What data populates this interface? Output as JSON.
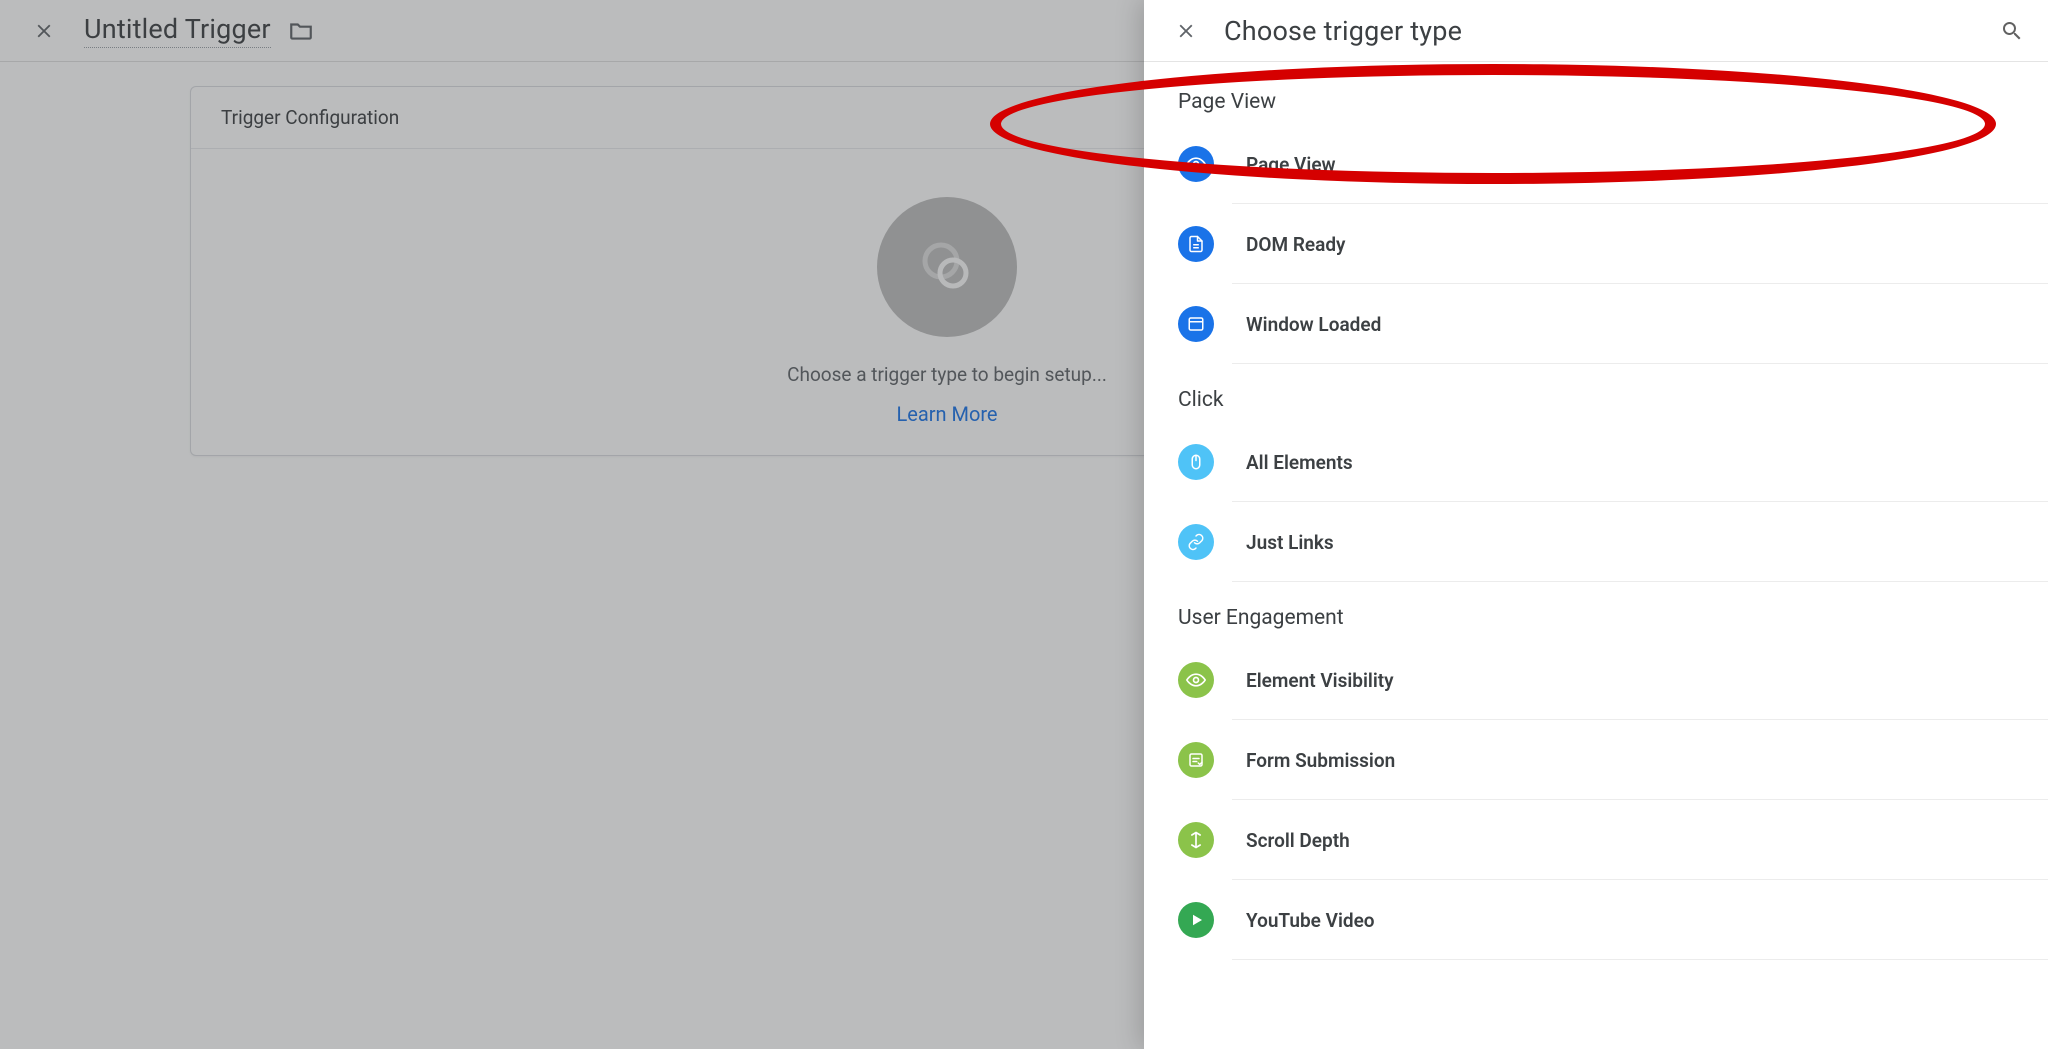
{
  "back": {
    "title": "Untitled Trigger",
    "card_title": "Trigger Configuration",
    "prompt": "Choose a trigger type to begin setup...",
    "learn_more": "Learn More"
  },
  "drawer": {
    "title": "Choose trigger type",
    "groups": [
      {
        "title": "Page View",
        "items": [
          {
            "name": "pageview",
            "label": "Page View",
            "icon": "eye-icon",
            "color": "ic-blue"
          },
          {
            "name": "dom-ready",
            "label": "DOM Ready",
            "icon": "doc-icon",
            "color": "ic-blue"
          },
          {
            "name": "window-loaded",
            "label": "Window Loaded",
            "icon": "window-icon",
            "color": "ic-blue"
          }
        ]
      },
      {
        "title": "Click",
        "items": [
          {
            "name": "all-elements",
            "label": "All Elements",
            "icon": "mouse-icon",
            "color": "ic-lblue"
          },
          {
            "name": "just-links",
            "label": "Just Links",
            "icon": "link-icon",
            "color": "ic-lblue"
          }
        ]
      },
      {
        "title": "User Engagement",
        "items": [
          {
            "name": "element-visibility",
            "label": "Element Visibility",
            "icon": "eye-icon",
            "color": "ic-green"
          },
          {
            "name": "form-submission",
            "label": "Form Submission",
            "icon": "form-icon",
            "color": "ic-green"
          },
          {
            "name": "scroll-depth",
            "label": "Scroll Depth",
            "icon": "scroll-icon",
            "color": "ic-green"
          },
          {
            "name": "youtube-video",
            "label": "YouTube Video",
            "icon": "play-icon",
            "color": "ic-dgreen"
          }
        ]
      }
    ]
  }
}
